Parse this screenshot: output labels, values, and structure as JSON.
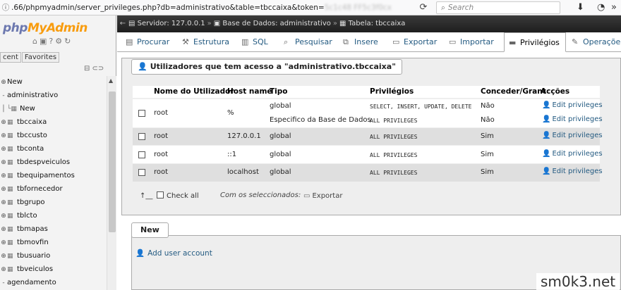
{
  "browser": {
    "url_prefix": ".66/phpmyadmin/server_privileges.php?db=administrativo&table=tbccaixa&token=",
    "url_blurred": "5c1c48 FF5c3f0cx",
    "search_placeholder": "Search",
    "icons": [
      "info-icon",
      "reload-icon",
      "search-icon",
      "download-icon",
      "dashboard-icon",
      "more-icon"
    ]
  },
  "nav": {
    "logo_php": "php",
    "logo_myadmin": "MyAdmin",
    "tabs": [
      "cent",
      "Favorites"
    ],
    "tree": [
      {
        "label": "New",
        "level": 0,
        "type": "new"
      },
      {
        "label": "administrativo",
        "level": 0,
        "type": "db"
      },
      {
        "label": "New",
        "level": 1,
        "type": "new"
      },
      {
        "label": "tbccaixa",
        "level": 1,
        "type": "table"
      },
      {
        "label": "tbccusto",
        "level": 1,
        "type": "table"
      },
      {
        "label": "tbconta",
        "level": 1,
        "type": "table"
      },
      {
        "label": "tbdespveiculos",
        "level": 1,
        "type": "table"
      },
      {
        "label": "tbequipamentos",
        "level": 1,
        "type": "table"
      },
      {
        "label": "tbfornecedor",
        "level": 1,
        "type": "table"
      },
      {
        "label": "tbgrupo",
        "level": 1,
        "type": "table"
      },
      {
        "label": "tblcto",
        "level": 1,
        "type": "table"
      },
      {
        "label": "tbmapas",
        "level": 1,
        "type": "table"
      },
      {
        "label": "tbmovfin",
        "level": 1,
        "type": "table"
      },
      {
        "label": "tbusuario",
        "level": 1,
        "type": "table"
      },
      {
        "label": "tbveiculos",
        "level": 1,
        "type": "table"
      },
      {
        "label": "agendamento",
        "level": 0,
        "type": "db"
      }
    ]
  },
  "breadcrumb": {
    "server": "Servidor: 127.0.0.1",
    "database": "Base de Dados: administrativo",
    "table": "Tabela: tbccaixa"
  },
  "tabs": [
    {
      "label": "Procurar",
      "icon": "browse-icon"
    },
    {
      "label": "Estrutura",
      "icon": "structure-icon"
    },
    {
      "label": "SQL",
      "icon": "sql-icon"
    },
    {
      "label": "Pesquisar",
      "icon": "search-icon"
    },
    {
      "label": "Insere",
      "icon": "insert-icon"
    },
    {
      "label": "Exportar",
      "icon": "export-icon"
    },
    {
      "label": "Importar",
      "icon": "import-icon"
    },
    {
      "label": "Privilégios",
      "icon": "privileges-icon"
    },
    {
      "label": "Operaçõe",
      "icon": "operations-icon"
    }
  ],
  "privileges": {
    "legend": "Utilizadores que tem acesso a \"administrativo.tbccaixa\"",
    "columns": [
      "Nome do Utilizador",
      "Host name",
      "Tipo",
      "Privilégios",
      "Conceder/Grant",
      "Acções"
    ],
    "rows": [
      {
        "user": "root",
        "host": "%",
        "entries": [
          {
            "type": "global",
            "privileges": "SELECT, INSERT, UPDATE, DELETE",
            "grant": "Não",
            "action": "Edit privileges"
          },
          {
            "type": "Especifico da Base de Dados",
            "privileges": "ALL PRIVILEGES",
            "grant": "Não",
            "action": "Edit privileges"
          }
        ]
      },
      {
        "user": "root",
        "host": "127.0.0.1",
        "entries": [
          {
            "type": "global",
            "privileges": "ALL PRIVILEGES",
            "grant": "Sim",
            "action": "Edit privileges"
          }
        ]
      },
      {
        "user": "root",
        "host": "::1",
        "entries": [
          {
            "type": "global",
            "privileges": "ALL PRIVILEGES",
            "grant": "Sim",
            "action": "Edit privileges"
          }
        ]
      },
      {
        "user": "root",
        "host": "localhost",
        "entries": [
          {
            "type": "global",
            "privileges": "ALL PRIVILEGES",
            "grant": "Sim",
            "action": "Edit privileges"
          }
        ]
      }
    ],
    "check_all": "Check all",
    "with_selected": "Com os seleccionados:",
    "export": "Exportar"
  },
  "new_panel": {
    "legend": "New",
    "add_user": "Add user account"
  },
  "watermark": "sm0k3.net"
}
